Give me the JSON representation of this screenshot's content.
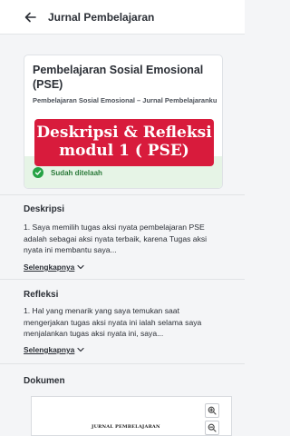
{
  "header": {
    "title": "Jurnal Pembelajaran"
  },
  "card": {
    "title": "Pembelajaran Sosial Emosional (PSE)",
    "subtitle": "Pembelajaran Sosial Emosional – Jurnal Pembelajaranku",
    "status": "Sudah ditelaah"
  },
  "overlay": {
    "line1": "Deskripsi & Refleksi",
    "line2": "modul 1 ( PSE)"
  },
  "deskripsi": {
    "title": "Deskripsi",
    "body": "1. Saya memilih tugas aksi nyata pembelajaran PSE adalah sebagai aksi nyata terbaik, karena Tugas aksi nyata ini membantu saya...",
    "more_label": "Selengkapnya"
  },
  "refleksi": {
    "title": "Refleksi",
    "body": "1. Hal yang menarik yang saya temukan saat mengerjakan tugas aksi nyata ini ialah selama saya menjalankan tugas aksi nyata ini, saya...",
    "more_label": "Selengkapnya"
  },
  "dokumen": {
    "title": "Dokumen",
    "doc_heading": "JURNAL PEMBELAJARAN"
  },
  "colors": {
    "accent_red": "#d81b3c",
    "status_green": "#25a244",
    "status_bg": "#e6f4e6"
  },
  "icons": [
    "back-arrow-icon",
    "check-circle-icon",
    "chevron-down-icon",
    "zoom-in-icon",
    "zoom-out-icon"
  ]
}
